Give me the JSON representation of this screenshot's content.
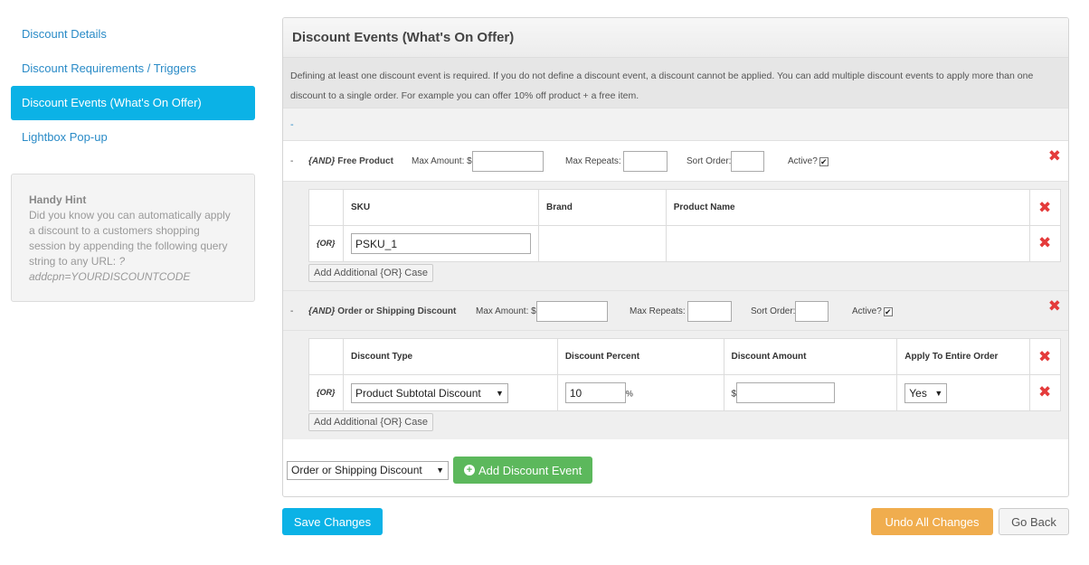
{
  "sidebar": {
    "items": [
      {
        "label": "Discount Details",
        "active": false
      },
      {
        "label": "Discount Requirements / Triggers",
        "active": false
      },
      {
        "label": "Discount Events (What's On Offer)",
        "active": true
      },
      {
        "label": "Lightbox Pop-up",
        "active": false
      }
    ],
    "hint": {
      "title": "Handy Hint",
      "text": "Did you know you can automatically apply a discount to a customers shopping session by appending the following query string to any URL: ",
      "code": "?addcpn=YOURDISCOUNTCODE"
    }
  },
  "panel": {
    "title": "Discount Events (What's On Offer)",
    "description": "Defining at least one discount event is required. If you do not define a discount event, a discount cannot be applied. You can add multiple discount events to apply more than one discount to a single order. For example you can offer 10% off product + a free item.",
    "dash": "-"
  },
  "events": [
    {
      "toggle": "-",
      "and_tag": "{AND}",
      "title": "Free Product",
      "max_amount_label": "Max Amount: $",
      "max_amount_value": "",
      "max_repeats_label": "Max Repeats:",
      "max_repeats_value": "",
      "sort_order_label": "Sort Order:",
      "sort_order_value": "",
      "active_label": "Active?",
      "active_mark": "✔",
      "table": {
        "headers": [
          "SKU",
          "Brand",
          "Product Name"
        ],
        "or_tag": "{OR}",
        "sku_value": "PSKU_1"
      },
      "add_case_label": "Add Additional {OR} Case"
    },
    {
      "toggle": "-",
      "and_tag": "{AND}",
      "title": "Order or Shipping Discount",
      "max_amount_label": "Max Amount: $",
      "max_amount_value": "",
      "max_repeats_label": "Max Repeats:",
      "max_repeats_value": "",
      "sort_order_label": "Sort Order:",
      "sort_order_value": "",
      "active_label": "Active?",
      "active_mark": "✔",
      "table": {
        "headers": [
          "Discount Type",
          "Discount Percent",
          "Discount Amount",
          "Apply To Entire Order"
        ],
        "or_tag": "{OR}",
        "discount_type": "Product Subtotal Discount",
        "discount_percent": "10",
        "percent_sign": "%",
        "dollar_sign": "$",
        "discount_amount": "",
        "apply_entire": "Yes"
      },
      "add_case_label": "Add Additional {OR} Case"
    }
  ],
  "add_event": {
    "selected": "Order or Shipping Discount",
    "button_label": "Add Discount Event"
  },
  "actions": {
    "save": "Save Changes",
    "undo": "Undo All Changes",
    "back": "Go Back"
  },
  "icons": {
    "delete": "✖",
    "caret": "▼",
    "plus": "+"
  },
  "colors": {
    "accent": "#0bb2e6",
    "success": "#5cb85c",
    "warning": "#f0ad4e",
    "danger": "#e43b3b"
  }
}
